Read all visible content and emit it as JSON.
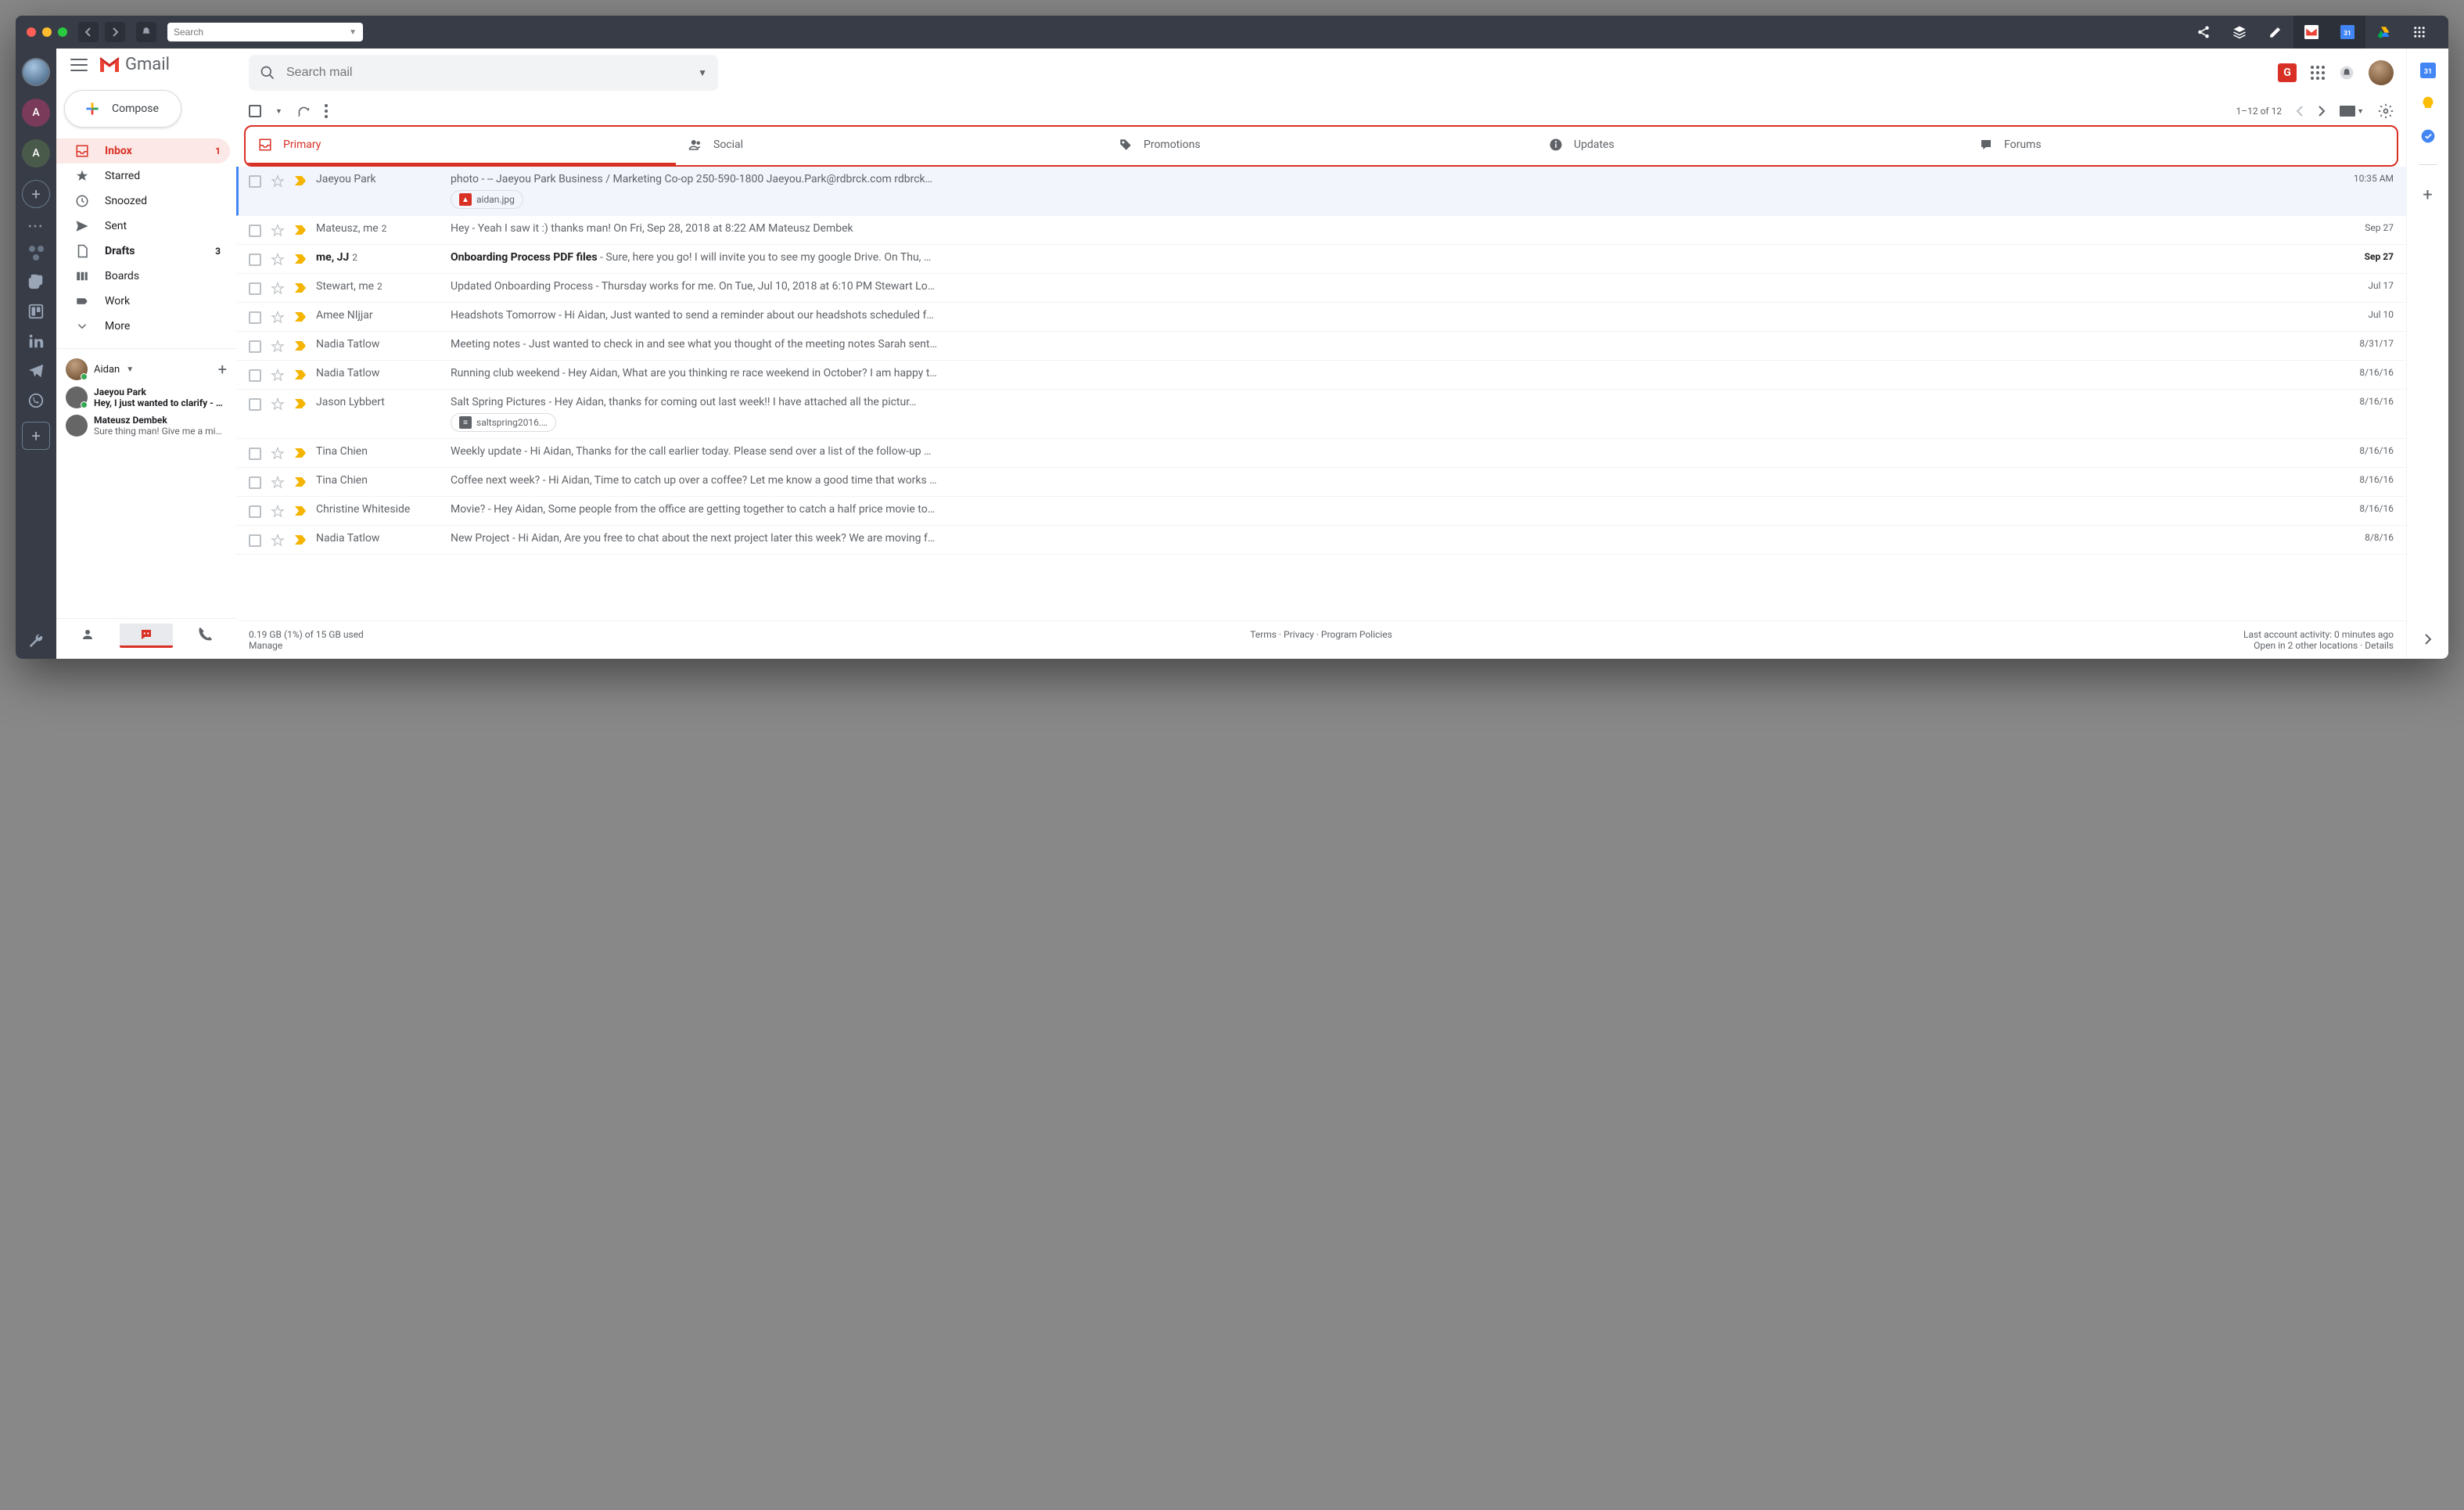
{
  "titlebar": {
    "search_placeholder": "Search"
  },
  "gmail": {
    "brand": "Gmail",
    "compose": "Compose",
    "search_placeholder": "Search mail",
    "nav": [
      {
        "label": "Inbox",
        "count": "1",
        "active": true
      },
      {
        "label": "Starred"
      },
      {
        "label": "Snoozed"
      },
      {
        "label": "Sent"
      },
      {
        "label": "Drafts",
        "count": "3",
        "bold": true
      },
      {
        "label": "Boards"
      },
      {
        "label": "Work"
      },
      {
        "label": "More"
      }
    ],
    "hangouts": {
      "user": "Aidan",
      "chats": [
        {
          "name": "Jaeyou Park",
          "msg": "Hey, I just wanted to clarify - did yo",
          "bold": true
        },
        {
          "name": "Mateusz Dembek",
          "msg": "Sure thing man! Give me a minute."
        }
      ]
    },
    "pagination": "1–12 of 12",
    "tabs": [
      "Primary",
      "Social",
      "Promotions",
      "Updates",
      "Forums"
    ],
    "mails": [
      {
        "from": "Jaeyou Park",
        "subj": "photo",
        "prev": "-- Jaeyou Park Business / Marketing Co-op 250-590-1800 Jaeyou.Park@rdbrck.com rdbrck…",
        "date": "10:35 AM",
        "chip": "aidan.jpg",
        "chipType": "img",
        "highlighted": true,
        "read": true
      },
      {
        "from": "Mateusz, me",
        "cnt": "2",
        "subj": "Hey",
        "prev": "Yeah I saw it :) thanks man! On Fri, Sep 28, 2018 at 8:22 AM Mateusz Dembek <contact@dem…",
        "date": "Sep 27",
        "read": true
      },
      {
        "from": "me, JJ",
        "cnt": "2",
        "subj": "Onboarding Process PDF files",
        "prev": "Sure, here you go! I will invite you to see my google Drive. On Thu, …",
        "date": "Sep 27",
        "unread": true
      },
      {
        "from": "Stewart, me",
        "cnt": "2",
        "subj": "Updated Onboarding Process",
        "prev": "Thursday works for me. On Tue, Jul 10, 2018 at 6:10 PM Stewart Lo…",
        "date": "Jul 17",
        "read": true
      },
      {
        "from": "Amee NIjjar",
        "subj": "Headshots Tomorrow",
        "prev": "Hi Aidan, Just wanted to send a reminder about our headshots scheduled f…",
        "date": "Jul 10",
        "read": true
      },
      {
        "from": "Nadia Tatlow",
        "subj": "Meeting notes",
        "prev": "Just wanted to check in and see what you thought of the meeting notes Sarah sent…",
        "date": "8/31/17",
        "read": true
      },
      {
        "from": "Nadia Tatlow",
        "subj": "Running club weekend",
        "prev": "Hey Aidan, What are you thinking re race weekend in October? I am happy t…",
        "date": "8/16/16",
        "read": true
      },
      {
        "from": "Jason Lybbert",
        "subj": "Salt Spring Pictures",
        "prev": "Hey Aidan, thanks for coming out last week!! I have attached all the pictur…",
        "date": "8/16/16",
        "chip": "saltspring2016.…",
        "chipType": "doc",
        "read": true
      },
      {
        "from": "Tina Chien",
        "subj": "Weekly update",
        "prev": "Hi Aidan, Thanks for the call earlier today. Please send over a list of the follow-up …",
        "date": "8/16/16",
        "read": true
      },
      {
        "from": "Tina Chien",
        "subj": "Coffee next week?",
        "prev": "Hi Aidan, Time to catch up over a coffee? Let me know a good time that works …",
        "date": "8/16/16",
        "read": true
      },
      {
        "from": "Christine Whiteside",
        "subj": "Movie?",
        "prev": "Hey Aidan, Some people from the office are getting together to catch a half price movie to…",
        "date": "8/16/16",
        "read": true
      },
      {
        "from": "Nadia Tatlow",
        "subj": "New Project",
        "prev": "Hi Aidan, Are you free to chat about the next project later this week? We are moving f…",
        "date": "8/8/16",
        "read": true
      }
    ],
    "footer": {
      "storage": "0.19 GB (1%) of 15 GB used",
      "manage": "Manage",
      "links": "Terms · Privacy · Program Policies",
      "activity": "Last account activity: 0 minutes ago",
      "open": "Open in 2 other locations · Details"
    }
  }
}
